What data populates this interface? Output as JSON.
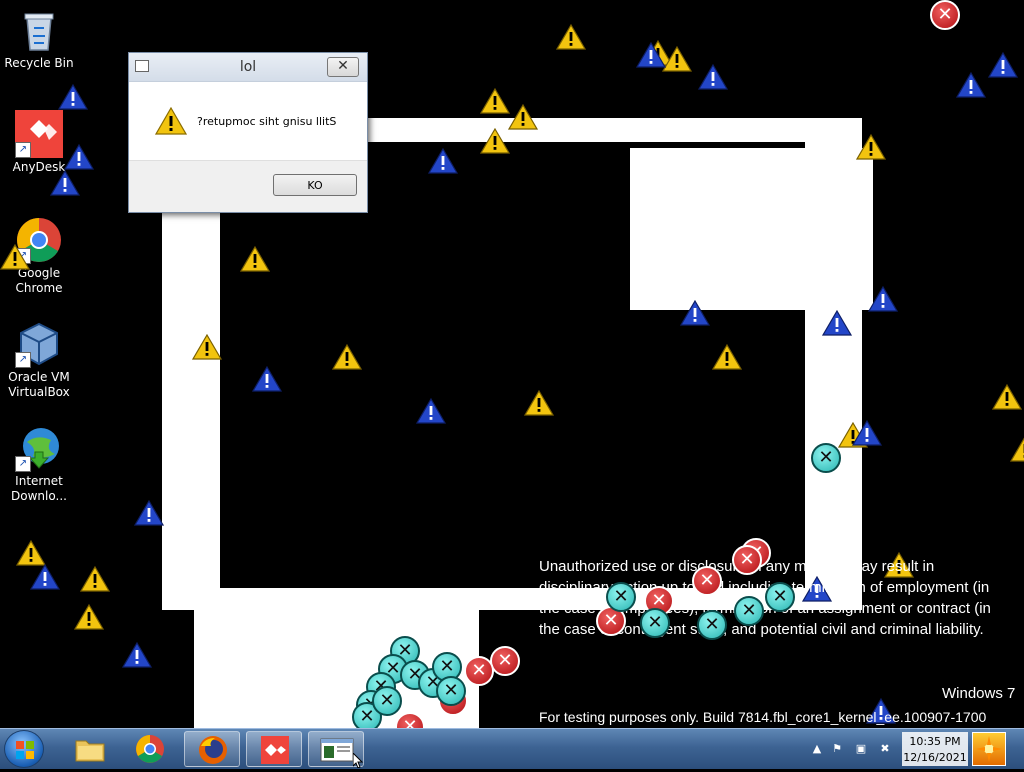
{
  "desktop_icons": [
    {
      "label": "Recycle Bin"
    },
    {
      "label": "AnyDesk"
    },
    {
      "label": "Google Chrome"
    },
    {
      "label": "Oracle VM VirtualBox"
    },
    {
      "label": "Internet Downlo..."
    }
  ],
  "dialog": {
    "title": "lol",
    "message": "?retupmoc siht gnisu llitS",
    "ok_label": "KO",
    "close_symbol": "✕"
  },
  "watermark": {
    "lines": [
      "Unauthorized use or disclosure in any manner may result in",
      "disciplinary action up to and including termination of employment (in",
      "the case of employees), termination of an assignment or contract (in",
      "the case of contingent staff), and potential civil and criminal liability."
    ],
    "os_name": "Windows 7",
    "build": "For testing purposes only. Build 7814.fbl_core1_kernel_ee.100907-1700"
  },
  "taskbar": {
    "clock_time": "10:35 PM",
    "clock_date": "12/16/2021"
  },
  "colors": {
    "warning_yellow": "#f2c40f",
    "info_blue": "#2346c8",
    "error_red": "#c8141a",
    "cyan_ball": "#45d2cf"
  }
}
